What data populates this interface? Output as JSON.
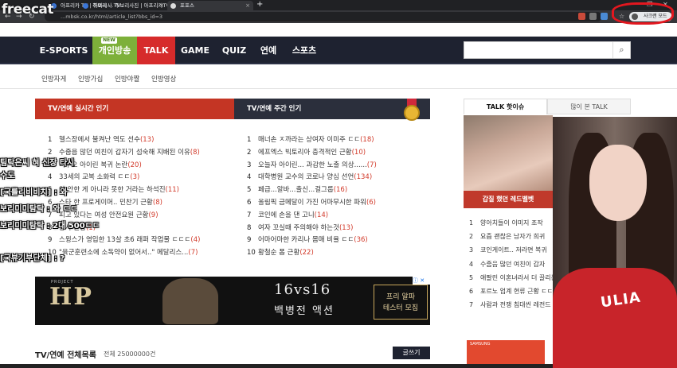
{
  "overlay_logo": "freecat",
  "browser": {
    "tabs": [
      {
        "label": "아프리카 TV | 하이시사 TV",
        "active": false
      },
      {
        "label": "주보리 ... 주보리사진 | 아프리카TV",
        "active": false
      },
      {
        "label": "포포스",
        "active": true
      }
    ],
    "tab_close": "×",
    "new_tab": "+",
    "window_controls": [
      "─",
      "❐",
      "✕"
    ],
    "nav": {
      "back": "←",
      "forward": "→",
      "reload": "↻"
    },
    "url": "...mbsk.co.kr/html/article_list?bbs_id=3",
    "profile_label": "사크랜 모드",
    "star_icon": "☆"
  },
  "site": {
    "nav": [
      {
        "label": "E-SPORTS"
      },
      {
        "label": "개인방송",
        "badge": "NEW"
      },
      {
        "label": "TALK"
      },
      {
        "label": "GAME"
      },
      {
        "label": "QUIZ"
      },
      {
        "label": "연예"
      },
      {
        "label": "스포츠"
      }
    ],
    "search_icon": "⌕",
    "subnav": [
      "인방자게",
      "인방가십",
      "인방야짤",
      "인방영상"
    ]
  },
  "realtime": {
    "title": "TV/연예 실시간 인기",
    "items": [
      {
        "num": "1",
        "text": "헬스장에서 불켜난 역도 선수",
        "count": "(13)"
      },
      {
        "num": "2",
        "text": "수줍음 많던 여친이 갑자기 섬숙해 지배된 이유",
        "count": "(8)"
      },
      {
        "num": "3",
        "text": "너무오 아이린 복귀 논란",
        "count": "(20)"
      },
      {
        "num": "4",
        "text": "33세의 교복 소화력 ㄷㄷ",
        "count": "(3)"
      },
      {
        "num": "5",
        "text": "안 안한 게 아니라 못한 거라는 하석진",
        "count": "(11)"
      },
      {
        "num": "6",
        "text": "스타 한 프로게이머.. 민찬기 근황",
        "count": "(8)"
      },
      {
        "num": "7",
        "text": "피고 있다는 여성 안전요원 근황",
        "count": "(9)"
      },
      {
        "num": "8",
        "text": "공사 근황",
        "count": "(1)"
      },
      {
        "num": "9",
        "text": "스윙스가 영입한 13살 초6 래퍼 작업물 ㄷㄷㄷ",
        "count": "(4)"
      },
      {
        "num": "10",
        "text": "\"육군훈련소에 소독약이 없어서..\" 메달리스...",
        "count": "(7)"
      }
    ]
  },
  "weekly": {
    "title": "TV/연예 주간 인기",
    "items": [
      {
        "num": "1",
        "text": "매너손 ㅈ까라는 상여자 이미주 ㄷㄷ",
        "count": "(18)"
      },
      {
        "num": "2",
        "text": "에프엑스 빅토리아 충격적인 근황",
        "count": "(10)"
      },
      {
        "num": "3",
        "text": "오늘자 아이린... 과감한 노출 의상......",
        "count": "(7)"
      },
      {
        "num": "4",
        "text": "대학병원 교수의 코로나 양심 선언",
        "count": "(134)"
      },
      {
        "num": "5",
        "text": "페급...알바...출신...걸그룹",
        "count": "(16)"
      },
      {
        "num": "6",
        "text": "올림픽 금메달이 가진 어마무시한 파워",
        "count": "(6)"
      },
      {
        "num": "7",
        "text": "코인에 손을 댄 고니",
        "count": "(14)"
      },
      {
        "num": "8",
        "text": "여자 꼬실때 주의해야 하는것",
        "count": "(13)"
      },
      {
        "num": "9",
        "text": "어마어마한 카리나 몸매 비율 ㄷㄷ",
        "count": "(36)"
      },
      {
        "num": "10",
        "text": "황철순 폼 근황",
        "count": "(22)"
      }
    ]
  },
  "ad": {
    "project": "PROJECT",
    "logo": "HP",
    "headline": "16vs16",
    "sub": "백병전 액션",
    "box_line1": "프리 알파",
    "box_line2": "테스터 모집",
    "icons": "ⓘ ✕"
  },
  "list": {
    "title": "TV/연예 전체목록",
    "count_label": "전체 25000000건",
    "write_label": "글쓰기"
  },
  "right": {
    "tab_on": "TALK 핫이슈",
    "tab_off": "많이 본 TALK",
    "caption": "갑질 했던 레드벨벳",
    "items": [
      {
        "num": "1",
        "text": "양아치들이 이미지 조작"
      },
      {
        "num": "2",
        "text": "요즘 괜찮은 남자가 희귀"
      },
      {
        "num": "3",
        "text": "코인게이트.. 저라면 복귀"
      },
      {
        "num": "4",
        "text": "수줍음 많던 여친이 갑자"
      },
      {
        "num": "5",
        "text": "애팔린 이혼녀라서 더 끌리는 여캠"
      },
      {
        "num": "6",
        "text": "포르노 업계 현류 근황 ㄷㄷ"
      },
      {
        "num": "7",
        "text": "사람과 전쟁 침대씬 레전드"
      }
    ],
    "ad2_brand": "SAMSUNG",
    "ad2_icons": "ⓘ ✕"
  },
  "webcam": {
    "shirt_text": "ULIA"
  },
  "chat": [
    {
      "text": "팀탁은씨 혀 신장 타시"
    },
    {
      "text": "수도"
    },
    {
      "text": "[국룰리비비치] : 와"
    },
    {
      "text": "보리미미탐탁 : 와 ㄷㄷ"
    },
    {
      "text": "보리미미탐탁 : 2대 500ㄷㄷ"
    },
    {
      "text": "[국뷰기부단체] : ?"
    }
  ]
}
